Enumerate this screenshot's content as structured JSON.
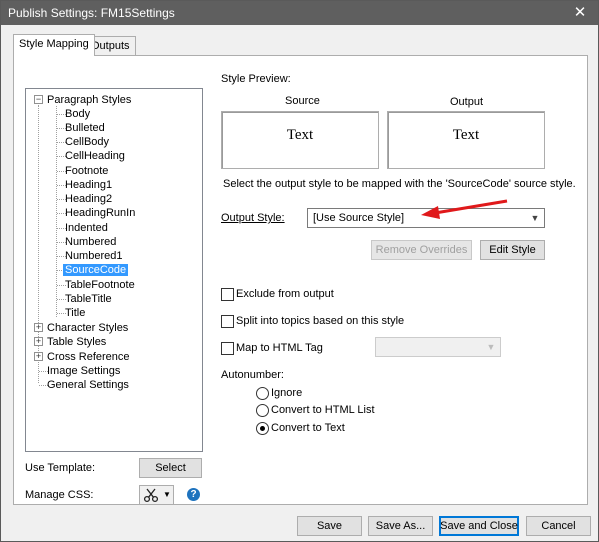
{
  "window": {
    "title": "Publish Settings: FM15Settings",
    "close_glyph": "✕"
  },
  "tabs": [
    {
      "label": "Style Mapping",
      "active": true
    },
    {
      "label": "Outputs",
      "active": false
    }
  ],
  "tree": {
    "paragraph_styles": {
      "label": "Paragraph Styles",
      "expanded": true,
      "children": [
        "Body",
        "Bulleted",
        "CellBody",
        "CellHeading",
        "Footnote",
        "Heading1",
        "Heading2",
        "HeadingRunIn",
        "Indented",
        "Numbered",
        "Numbered1",
        "SourceCode",
        "TableFootnote",
        "TableTitle",
        "Title"
      ],
      "selected": "SourceCode"
    },
    "groups": [
      {
        "label": "Character Styles",
        "expandable": true
      },
      {
        "label": "Table Styles",
        "expandable": true
      },
      {
        "label": "Cross Reference",
        "expandable": true
      },
      {
        "label": "Image Settings",
        "expandable": false
      },
      {
        "label": "General Settings",
        "expandable": false
      }
    ]
  },
  "preview": {
    "heading": "Style Preview:",
    "source_label": "Source",
    "output_label": "Output",
    "source_text": "Text",
    "output_text": "Text",
    "instruction": "Select the output style to be mapped with the 'SourceCode' source style."
  },
  "output_style": {
    "label": "Output Style:",
    "value": "[Use Source Style]",
    "annotation_arrow_color": "#e0191b"
  },
  "buttons": {
    "remove_overrides": "Remove Overrides",
    "edit_style": "Edit Style",
    "select": "Select",
    "save": "Save",
    "save_as": "Save As...",
    "save_and_close": "Save and Close",
    "cancel": "Cancel"
  },
  "options": {
    "exclude": {
      "label": "Exclude from output",
      "checked": false
    },
    "split": {
      "label": "Split into topics based on this style",
      "checked": false
    },
    "map_html": {
      "label": "Map to HTML Tag",
      "checked": false,
      "value": ""
    }
  },
  "autonumber": {
    "label": "Autonumber:",
    "options": [
      {
        "label": "Ignore",
        "selected": false
      },
      {
        "label": "Convert to HTML List",
        "selected": false
      },
      {
        "label": "Convert to Text",
        "selected": true
      }
    ]
  },
  "template": {
    "label": "Use Template:"
  },
  "css": {
    "label": "Manage CSS:",
    "icon": "scissors-icon",
    "help_icon": "help-icon"
  },
  "colors": {
    "accent": "#3399ff",
    "title_bar": "#5f5f5f",
    "help": "#1e73be"
  }
}
